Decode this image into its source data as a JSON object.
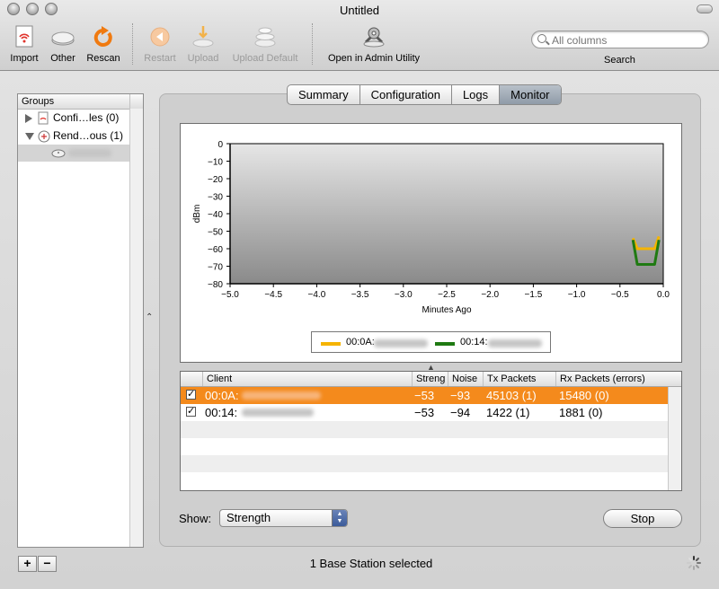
{
  "window": {
    "title": "Untitled"
  },
  "toolbar": {
    "import": "Import",
    "other": "Other",
    "rescan": "Rescan",
    "restart": "Restart",
    "upload": "Upload",
    "upload_default": "Upload Default",
    "admin_utility": "Open in Admin Utility",
    "search_placeholder": "All columns",
    "search_label": "Search"
  },
  "sidebar": {
    "header": "Groups",
    "items": [
      {
        "label": "Confi…les (0)",
        "expanded": false
      },
      {
        "label": "Rend…ous (1)",
        "expanded": true
      }
    ],
    "add": "+",
    "remove": "−"
  },
  "tabs": [
    {
      "label": "Summary",
      "active": false
    },
    {
      "label": "Configuration",
      "active": false
    },
    {
      "label": "Logs",
      "active": false
    },
    {
      "label": "Monitor",
      "active": true
    }
  ],
  "chart_data": {
    "type": "line",
    "xlabel": "Minutes Ago",
    "ylabel": "dBm",
    "xlim": [
      -5.0,
      0.0
    ],
    "ylim": [
      -80,
      0
    ],
    "xticks": [
      "−5.0",
      "−4.5",
      "−4.0",
      "−3.5",
      "−3.0",
      "−2.5",
      "−2.0",
      "−1.5",
      "−1.0",
      "−0.5",
      "0.0"
    ],
    "yticks": [
      "0",
      "−10",
      "−20",
      "−30",
      "−40",
      "−50",
      "−60",
      "−70",
      "−80"
    ],
    "grid": false,
    "legend_position": "bottom",
    "series": [
      {
        "name": "00:0A:",
        "color": "#f5b400",
        "x": [
          -0.35,
          -0.3,
          -0.25,
          -0.2,
          -0.15,
          -0.1,
          -0.05
        ],
        "y": [
          -54,
          -60,
          -60,
          -60,
          -60,
          -60,
          -53
        ]
      },
      {
        "name": "00:14:",
        "color": "#1f7a12",
        "x": [
          -0.35,
          -0.3,
          -0.25,
          -0.2,
          -0.15,
          -0.1,
          -0.05
        ],
        "y": [
          -55,
          -69,
          -69,
          -69,
          -69,
          -69,
          -55
        ]
      }
    ]
  },
  "table": {
    "columns": [
      "Client",
      "Streng",
      "Noise",
      "Tx Packets",
      "Rx Packets (errors)"
    ],
    "rows": [
      {
        "client": "00:0A:",
        "strength": "−53",
        "noise": "−93",
        "tx": "45103 (1)",
        "rx": "15480 (0)",
        "checked": true,
        "selected": true
      },
      {
        "client": "00:14:",
        "strength": "−53",
        "noise": "−94",
        "tx": "1422 (1)",
        "rx": "1881 (0)",
        "checked": true,
        "selected": false
      }
    ]
  },
  "controls": {
    "show_label": "Show:",
    "show_value": "Strength",
    "stop": "Stop"
  },
  "status": "1 Base Station selected",
  "colors": {
    "selection": "#f48a1c",
    "series1": "#f5b400",
    "series2": "#1f7a12"
  }
}
